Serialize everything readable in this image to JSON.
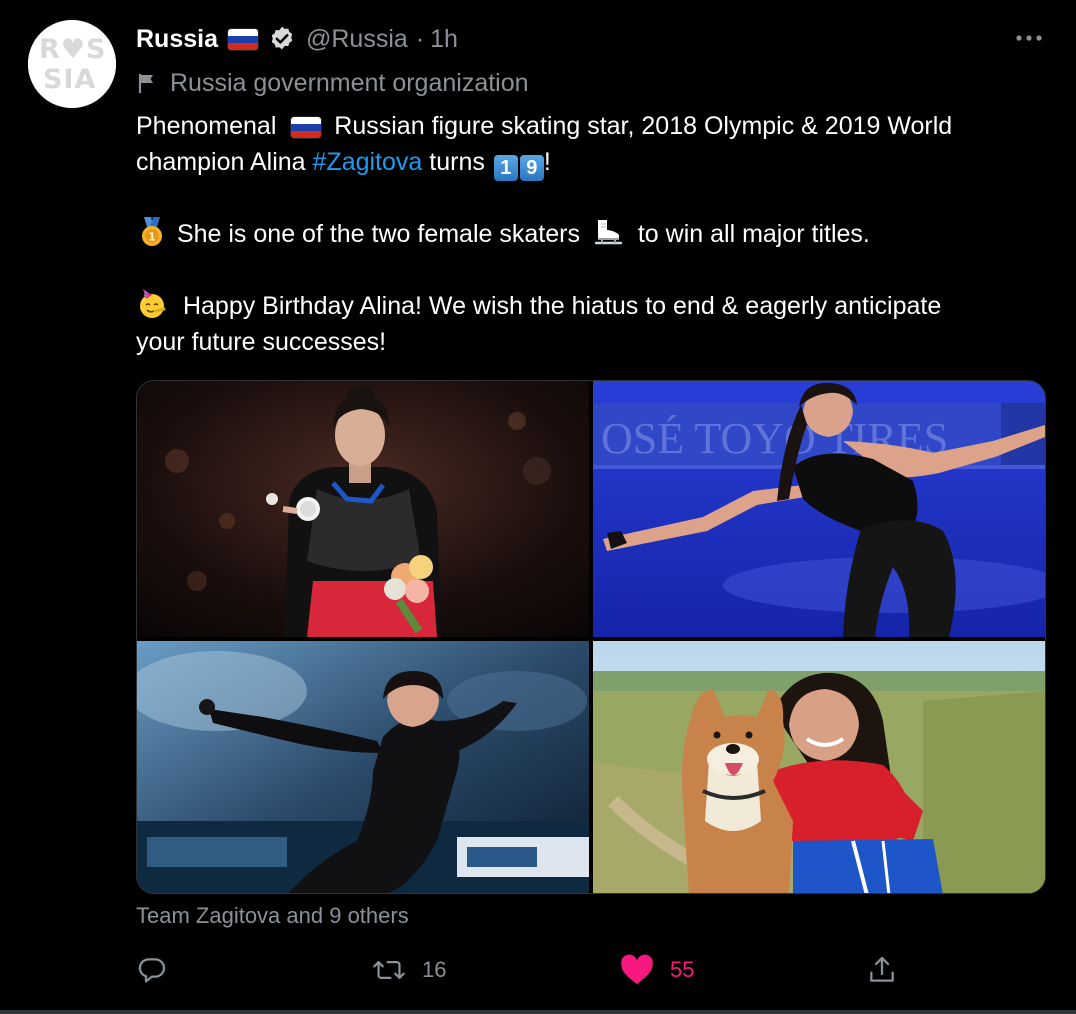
{
  "author": {
    "avatar_text_top": "R♥S",
    "avatar_text_bottom": "SIA",
    "name": "Russia",
    "handle": "@Russia",
    "separator": "·",
    "time": "1h",
    "verified": true,
    "label": "Russia government organization"
  },
  "tweet": {
    "line1_a": "Phenomenal",
    "line1_b": "Russian figure skating star, 2018 Olympic & 2019 World",
    "line2_a": "champion Alina",
    "hashtag": "#Zagitova",
    "line2_b": "turns",
    "keycap_1": "1",
    "keycap_2": "9",
    "line2_end": "!",
    "line3_a": "She is one of the two female skaters",
    "line3_b": "to win all major titles.",
    "line4": "Happy Birthday Alina! We wish the hiatus to end & eagerly anticipate",
    "line5": "your future successes!",
    "emojis": [
      "russia-flag-icon",
      "keycap-1",
      "keycap-9",
      "medal-icon",
      "ice-skate-icon",
      "party-face-icon"
    ]
  },
  "media": {
    "photos": [
      {
        "name": "photo-medal-ceremony",
        "sign_text": ""
      },
      {
        "name": "photo-skating-blue-rink",
        "sign_text": "OSÉ   TOYO TIRES"
      },
      {
        "name": "photo-skating-spiral",
        "sign_text": ""
      },
      {
        "name": "photo-with-dog",
        "sign_text": ""
      }
    ]
  },
  "social_context": "Team Zagitova and 9 others",
  "actions": {
    "reply_count": "",
    "retweet_count": "16",
    "like_count": "55",
    "liked": true
  },
  "colors": {
    "background": "#000000",
    "text": "#ffffff",
    "secondary": "#8b9197",
    "link": "#1d9bf0",
    "like": "#f91880",
    "border": "#2f3336"
  }
}
